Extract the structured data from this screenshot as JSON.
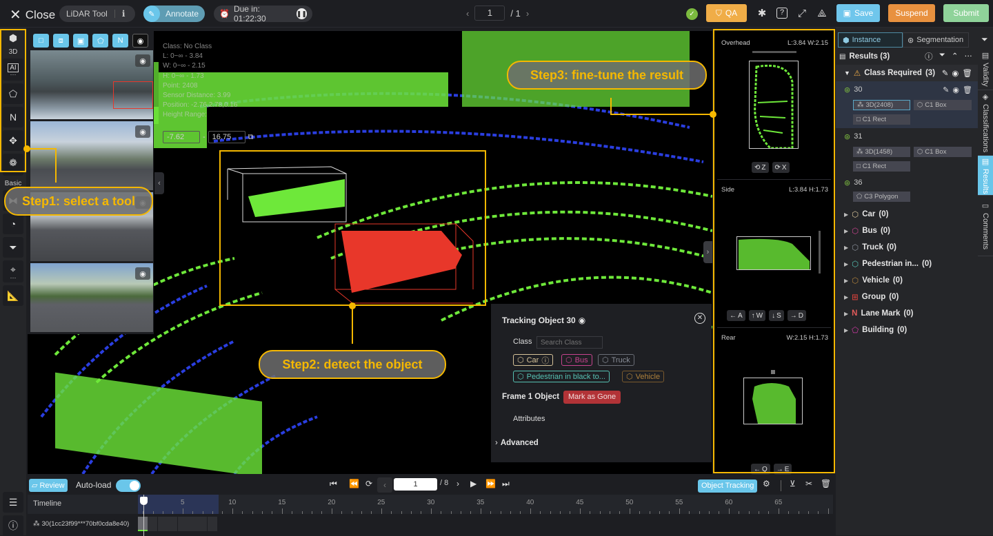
{
  "topbar": {
    "close_label": "Close",
    "tool_name": "LiDAR Tool",
    "info_icon": "info-icon",
    "mode_label": "Annotate",
    "due_label": "Due in: 01:22:30",
    "page_current": "1",
    "page_total": "/ 1",
    "qa_label": "QA",
    "save_label": "Save",
    "suspend_label": "Suspend",
    "submit_label": "Submit",
    "colors": {
      "qa": "#f0ad47",
      "save": "#6fc6ec",
      "suspend": "#e8913f",
      "submit": "#8fd39a",
      "accent": "#6ac6ea"
    }
  },
  "left_tools": {
    "section_3d": "3D",
    "section_basic": "Basic",
    "tools_3d": [
      "cube-icon",
      "ai-icon",
      "polygon-icon",
      "polyline-icon",
      "move-icon",
      "brain-icon"
    ],
    "tools_basic": [
      "cut-icon",
      "sensor-icon",
      "filter-icon",
      "focus-icon",
      "ruler-icon"
    ]
  },
  "camera_toolbar": [
    "rect-tool",
    "cube-tool",
    "cube-projection-tool",
    "polygon-tool",
    "polyline-tool",
    "point-tool"
  ],
  "info_overlay": {
    "class": "Class:  No Class",
    "l": "L:  0~∞ - 3.84",
    "w": "W:  0~∞ - 2.15",
    "h": "H:  0~∞ - 1.73",
    "points": "Point:  2408",
    "sensor_distance": "Sensor Distance:  3.99",
    "position": "Position:  -2.76,2.78,0.16",
    "height_range_label": "Height Range:",
    "height_min": "-7.62",
    "height_max": "16.75"
  },
  "callouts": {
    "step1": "Step1: select a tool",
    "step2": "Step2: detect the object",
    "step3": "Step3: fine-tune the result"
  },
  "tracking_panel": {
    "title": "Tracking Object 30",
    "class_label": "Class",
    "search_placeholder": "Search Class",
    "classes": [
      {
        "label": "Car",
        "color": "#d8c49a",
        "selected": true
      },
      {
        "label": "Bus",
        "color": "#c8448f"
      },
      {
        "label": "Truck",
        "color": "#8a8f99"
      },
      {
        "label": "Pedestrian in black to...",
        "color": "#56c2b4"
      },
      {
        "label": "Vehicle",
        "color": "#b0823c"
      }
    ],
    "frame_label": "Frame 1 Object",
    "mark_gone_label": "Mark as Gone",
    "attributes_label": "Attributes",
    "advanced_label": "Advanced"
  },
  "views": {
    "overhead": {
      "title": "Overhead",
      "dims": "L:3.84 W:2.15",
      "buttons": [
        "Z",
        "X"
      ]
    },
    "side": {
      "title": "Side",
      "dims": "L:3.84 H:1.73",
      "buttons": [
        "A",
        "W",
        "S",
        "D"
      ]
    },
    "rear": {
      "title": "Rear",
      "dims": "W:2.15 H:1.73",
      "buttons": [
        "Q",
        "E"
      ]
    }
  },
  "right_panel": {
    "tab_instance": "Instance",
    "tab_segmentation": "Segmentation",
    "results_label": "Results (3)",
    "group_label": "Class Required",
    "group_count": "(3)",
    "items": [
      {
        "id": "30",
        "tags": [
          "3D(2408)",
          "C1 Box",
          "C1 Rect"
        ],
        "selected": true
      },
      {
        "id": "31",
        "tags": [
          "3D(1458)",
          "C1 Box",
          "C1 Rect"
        ]
      },
      {
        "id": "36",
        "tags": [
          "C3 Polygon"
        ]
      }
    ],
    "classes": [
      {
        "name": "Car",
        "count": "(0)",
        "color": "#d8c49a"
      },
      {
        "name": "Bus",
        "count": "(0)",
        "color": "#c8448f"
      },
      {
        "name": "Truck",
        "count": "(0)",
        "color": "#8a8f99"
      },
      {
        "name": "Pedestrian in...",
        "count": "(0)",
        "color": "#56c2b4"
      },
      {
        "name": "Vehicle",
        "count": "(0)",
        "color": "#b0823c"
      },
      {
        "name": "Group",
        "count": "(0)",
        "color": "#c9403a"
      },
      {
        "name": "Lane Mark",
        "count": "(0)",
        "color": "#e05a5a"
      },
      {
        "name": "Building",
        "count": "(0)",
        "color": "#d43aa8"
      }
    ],
    "vertical_tabs": [
      "Validity",
      "Classifications",
      "Results",
      "Comments"
    ]
  },
  "bottom": {
    "review_label": "Review",
    "autoload_label": "Auto-load",
    "autoload_on": true,
    "frame_current": "1",
    "frame_total": "/ 8",
    "object_tracking_label": "Object Tracking",
    "timeline_label": "Timeline",
    "ticks": [
      "5",
      "10",
      "15",
      "20",
      "25",
      "30",
      "35",
      "40",
      "45",
      "50",
      "55",
      "60",
      "65"
    ],
    "track_label": "30(1cc23f99***70bf0cda8e40)"
  }
}
